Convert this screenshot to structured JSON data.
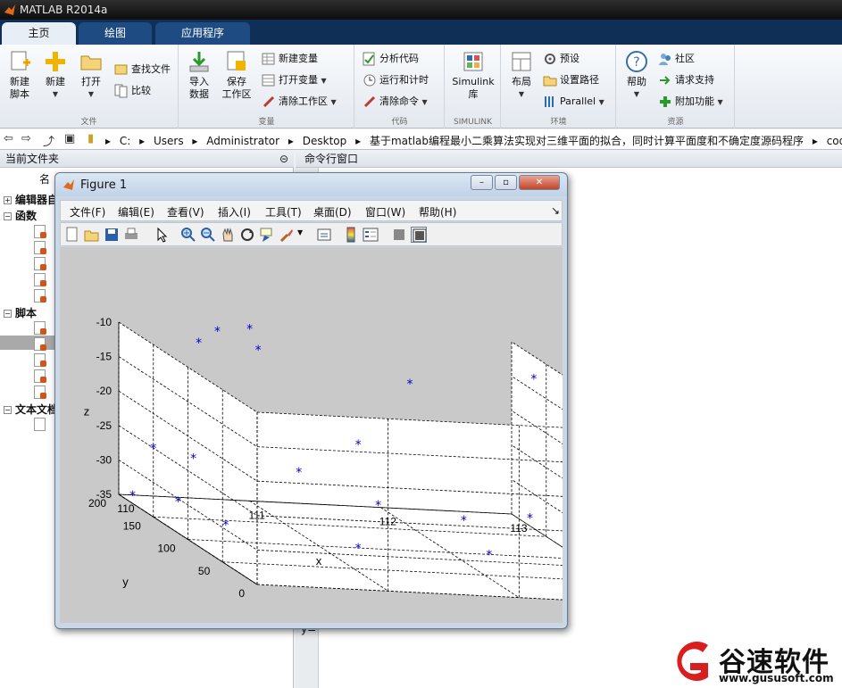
{
  "window": {
    "title": "MATLAB R2014a"
  },
  "tabs": [
    {
      "label": "主页"
    },
    {
      "label": "绘图"
    },
    {
      "label": "应用程序"
    }
  ],
  "ribbon": {
    "file": {
      "new_script": "新建\n脚本",
      "new": "新建",
      "open": "打开",
      "find_files": "查找文件",
      "compare": "比较",
      "section": "文件"
    },
    "variable": {
      "import": "导入\n数据",
      "save_ws": "保存\n工作区",
      "new_var": "新建变量",
      "open_var": "打开变量",
      "clear_ws": "清除工作区",
      "section": "变量"
    },
    "code": {
      "analyze": "分析代码",
      "run_time": "运行和计时",
      "clear_cmd": "清除命令",
      "section": "代码"
    },
    "simulink": {
      "lib": "Simulink\n库",
      "section": "SIMULINK"
    },
    "env": {
      "layout": "布局",
      "prefs": "预设",
      "set_path": "设置路径",
      "parallel": "Parallel",
      "section": "环境"
    },
    "resources": {
      "help": "帮助",
      "community": "社区",
      "support": "请求支持",
      "addons": "附加功能",
      "section": "资源"
    }
  },
  "address": {
    "crumbs": [
      "C:",
      "Users",
      "Administrator",
      "Desktop",
      "基于matlab编程最小二乘算法实现对三维平面的拟合，同时计算平面度和不确定度源码程序",
      "code"
    ]
  },
  "left_panel": {
    "title": "当前文件夹",
    "col_name": "名",
    "groups": [
      {
        "label": "编辑器自"
      },
      {
        "label": "函数"
      },
      {
        "label": "脚本"
      },
      {
        "label": "文本文档"
      }
    ]
  },
  "right_panel": {
    "title": "命令行窗口",
    "prompt": "y="
  },
  "figure": {
    "title": "Figure 1",
    "menu": [
      "文件(F)",
      "编辑(E)",
      "查看(V)",
      "插入(I)",
      "工具(T)",
      "桌面(D)",
      "窗口(W)",
      "帮助(H)"
    ],
    "toolbar_icons": [
      "new-figure-icon",
      "open-file-icon",
      "save-icon",
      "print-icon",
      "pointer-icon",
      "zoom-in-icon",
      "zoom-out-icon",
      "pan-icon",
      "rotate-icon",
      "data-cursor-icon",
      "brush-icon",
      "link-icon",
      "colorbar-icon",
      "legend-icon",
      "hide-plot-tools-icon",
      "show-plot-tools-icon"
    ]
  },
  "chart_data": {
    "type": "scatter",
    "title": "",
    "xlabel": "x",
    "ylabel": "y",
    "zlabel": "z",
    "x_ticks": [
      "110",
      "111",
      "112",
      "113"
    ],
    "y_ticks": [
      "0",
      "50",
      "100",
      "150",
      "200"
    ],
    "z_ticks": [
      "-10",
      "-15",
      "-20",
      "-25",
      "-30",
      "-35"
    ],
    "xlim": [
      110,
      113
    ],
    "ylim": [
      0,
      200
    ],
    "zlim": [
      -35,
      -10
    ],
    "grid": true,
    "marker": "*",
    "marker_color": "#0000cc",
    "points": [
      {
        "x": 110.1,
        "y": 199,
        "z": -35.0
      },
      {
        "x": 110.4,
        "y": 190,
        "z": -35.0
      },
      {
        "x": 110.5,
        "y": 140,
        "z": -35.0
      },
      {
        "x": 111.3,
        "y": 100,
        "z": -35.0
      },
      {
        "x": 112.3,
        "y": 100,
        "z": -35.0
      },
      {
        "x": 110.7,
        "y": 190,
        "z": -10.0
      },
      {
        "x": 110.4,
        "y": 160,
        "z": -10.0
      },
      {
        "x": 110.8,
        "y": 150,
        "z": -10.0
      },
      {
        "x": 111.0,
        "y": 200,
        "z": -10.0
      },
      {
        "x": 111.8,
        "y": 120,
        "z": -12.0
      },
      {
        "x": 112.9,
        "y": 60,
        "z": -12.0
      },
      {
        "x": 112.8,
        "y": 130,
        "z": -11.0
      },
      {
        "x": 111.3,
        "y": 100,
        "z": -20.0
      },
      {
        "x": 110.0,
        "y": 150,
        "z": -25.0
      },
      {
        "x": 110.2,
        "y": 130,
        "z": -25.0
      },
      {
        "x": 110.9,
        "y": 110,
        "z": -25.0
      },
      {
        "x": 111.4,
        "y": 90,
        "z": -28.0
      },
      {
        "x": 112.0,
        "y": 80,
        "z": -29.0
      },
      {
        "x": 112.4,
        "y": 60,
        "z": -27.0
      },
      {
        "x": 112.9,
        "y": 40,
        "z": -27.0
      }
    ]
  },
  "watermark": {
    "brand": "谷速软件",
    "url": "www.gususoft.com"
  },
  "colors": {
    "ribbon_tab_bg": "#0f2f57",
    "accent": "#1e4c82",
    "marker": "#0000cc",
    "logo_red": "#d81e1e"
  }
}
